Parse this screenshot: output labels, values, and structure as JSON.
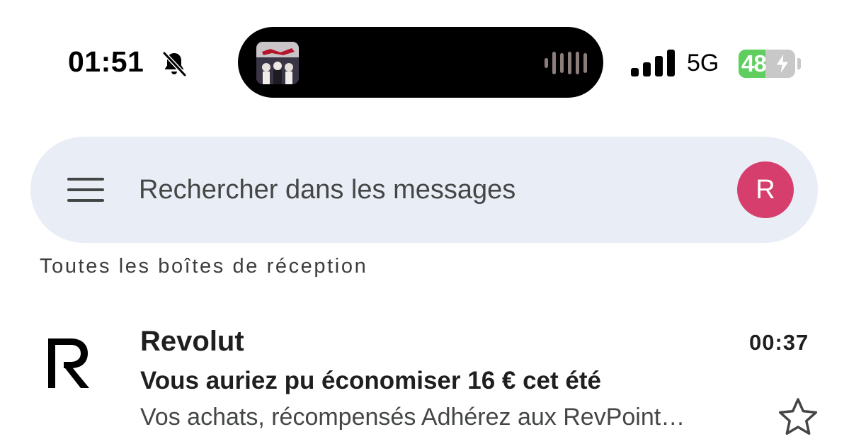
{
  "status_bar": {
    "time": "01:51",
    "network": "5G",
    "battery_level": "48",
    "icons": [
      "bell-slash-icon",
      "waveform-icon",
      "cellular-signal-icon",
      "battery-charging-icon"
    ]
  },
  "search": {
    "placeholder": "Rechercher dans les messages",
    "avatar_initial": "R"
  },
  "section": {
    "label": "Toutes les boîtes de réception"
  },
  "emails": [
    {
      "sender": "Revolut",
      "time": "00:37",
      "subject": "Vous auriez pu économiser 16 € cet été",
      "snippet": "Vos achats, récompensés Adhérez aux RevPoint…",
      "starred": false
    }
  ],
  "colors": {
    "avatar": "#d63e6d",
    "searchbar": "#e9edf5",
    "battery_fill": "#5fce5f"
  }
}
